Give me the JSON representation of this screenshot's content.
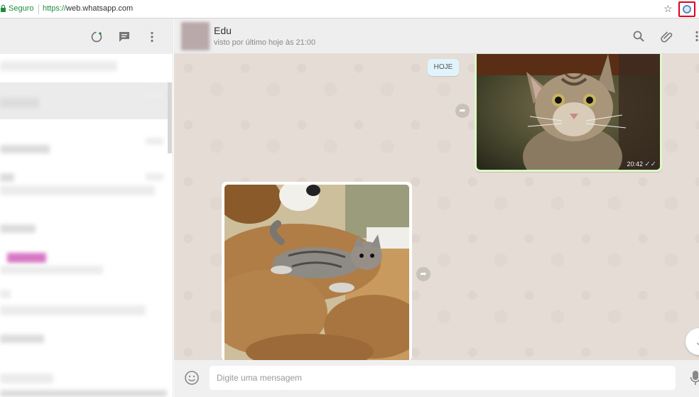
{
  "browser": {
    "secure_label": "Seguro",
    "url_scheme": "https://",
    "url_host": "web.whatsapp.com",
    "icons": [
      "lock-icon",
      "star-icon",
      "extension-icon"
    ]
  },
  "left_panel": {
    "header_icons": [
      "status-icon",
      "new-chat-icon",
      "menu-icon"
    ]
  },
  "chat": {
    "contact_name": "Edu",
    "contact_status": "visto por último hoje às 21:00",
    "header_icons": [
      "search-icon",
      "attach-icon",
      "menu-icon"
    ],
    "date_chip": "HOJE",
    "messages": [
      {
        "direction": "outgoing",
        "type": "image",
        "subject": "cat looking up",
        "time": "20:42",
        "status": "read"
      },
      {
        "direction": "incoming",
        "type": "image",
        "subject": "kitten on plush toy"
      }
    ],
    "composer": {
      "placeholder": "Digite uma mensagem",
      "icons": [
        "emoji-icon",
        "mic-icon"
      ]
    }
  },
  "colors": {
    "accent_highlight": "#e0001b",
    "outgoing_bubble": "#dcf8c6",
    "read_ticks": "#4fc3f7",
    "secure_green": "#1e8e3e"
  }
}
